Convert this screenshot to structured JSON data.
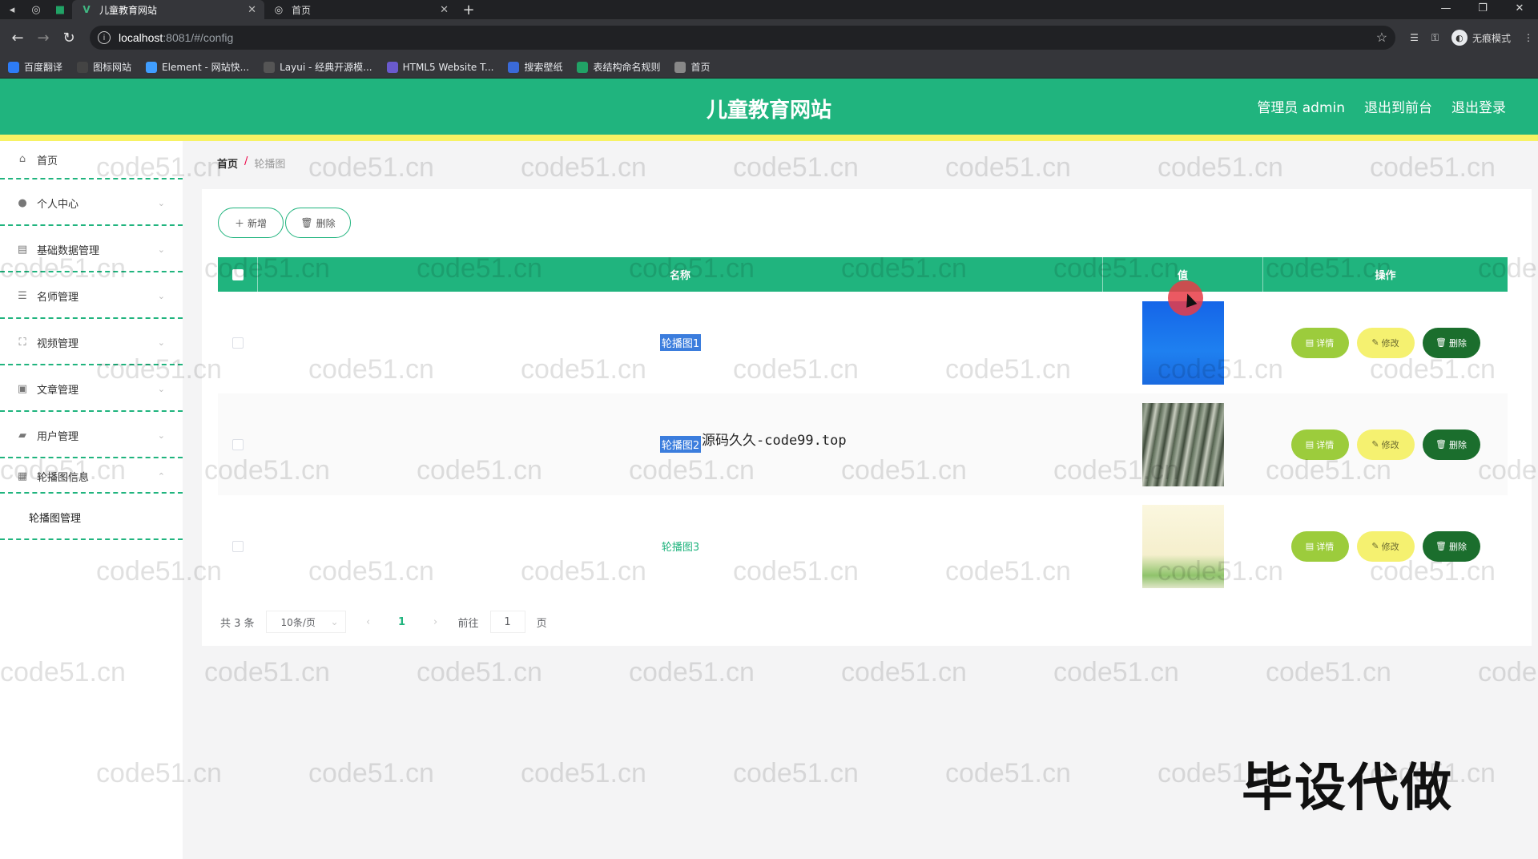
{
  "browser": {
    "tabs": [
      {
        "title": "儿童教育网站",
        "active": true
      },
      {
        "title": "首页",
        "active": false
      }
    ],
    "url_host": "localhost",
    "url_path": ":8081/#/config",
    "incognito_label": "无痕模式",
    "bookmarks": [
      {
        "label": "百度翻译",
        "icon_color": "#2d7cf6"
      },
      {
        "label": "图标网站",
        "icon_color": "#444444"
      },
      {
        "label": "Element - 网站快...",
        "icon_color": "#409eff"
      },
      {
        "label": "Layui - 经典开源模...",
        "icon_color": "#555555"
      },
      {
        "label": "HTML5 Website T...",
        "icon_color": "#6a5acd"
      },
      {
        "label": "搜索壁纸",
        "icon_color": "#3a6ad8"
      },
      {
        "label": "表结构命名规则",
        "icon_color": "#21a366"
      },
      {
        "label": "首页",
        "icon_color": "#888888"
      }
    ]
  },
  "header": {
    "site_title": "儿童教育网站",
    "admin_label": "管理员 admin",
    "to_front": "退出到前台",
    "logout": "退出登录"
  },
  "sidebar": {
    "items": [
      {
        "label": "首页",
        "icon": "home-icon"
      },
      {
        "label": "个人中心",
        "icon": "user-icon"
      },
      {
        "label": "基础数据管理",
        "icon": "message-icon"
      },
      {
        "label": "名师管理",
        "icon": "list-icon"
      },
      {
        "label": "视频管理",
        "icon": "fullscreen-icon"
      },
      {
        "label": "文章管理",
        "icon": "picture-icon"
      },
      {
        "label": "用户管理",
        "icon": "ticket-icon"
      },
      {
        "label": "轮播图信息",
        "icon": "grid-icon"
      }
    ],
    "submenu": "轮播图管理"
  },
  "breadcrumb": {
    "home": "首页",
    "sep": "/",
    "current": "轮播图"
  },
  "toolbar": {
    "add": "新增",
    "delete": "删除"
  },
  "table": {
    "headers": {
      "name": "名称",
      "value": "值",
      "ops": "操作"
    },
    "rows": [
      {
        "name": "轮播图1",
        "image": "blue"
      },
      {
        "name": "轮播图2",
        "image": "forest"
      },
      {
        "name": "轮播图3",
        "image": "paper"
      }
    ],
    "op_labels": {
      "detail": "详情",
      "edit": "修改",
      "del": "删除"
    }
  },
  "overlay_text": "源码久久-code99.top",
  "pagination": {
    "total": "共 3 条",
    "page_size": "10条/页",
    "current_page": "1",
    "goto_prefix": "前往",
    "goto_value": "1",
    "goto_suffix": "页"
  },
  "watermark": "code51.cn",
  "corner_text": "毕设代做",
  "colors": {
    "primary": "#20b47e",
    "accent": "#f7f264",
    "edit": "#f5f170",
    "detail": "#9ccc3c",
    "delete": "#1b6e2d"
  }
}
